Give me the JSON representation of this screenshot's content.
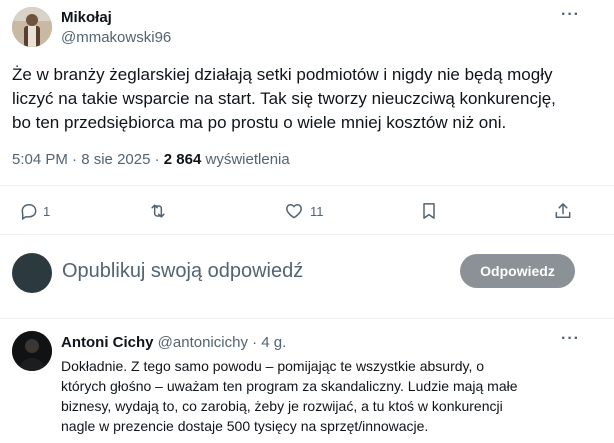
{
  "post": {
    "author_name": "Mikołaj",
    "author_handle": "@mmakowski96",
    "text_line1": "Że w branży żeglarskiej działają setki podmiotów i nigdy nie będą mogły",
    "text_line2": "liczyć na takie wsparcie na start. Tak się tworzy nieuczciwą konkurencję,",
    "text_line3": "bo ten przedsiębiorca ma po prostu o wiele mniej kosztów niż oni.",
    "time": "5:04 PM",
    "sep": "·",
    "date": "8 sie 2025",
    "views_count": "2 864",
    "views_label": "wyświetlenia",
    "more": "···",
    "actions": {
      "reply_count": "1",
      "repost_count": "",
      "like_count": "11",
      "icons": [
        "reply-icon",
        "repost-icon",
        "like-icon",
        "bookmark-icon",
        "share-icon"
      ]
    }
  },
  "composer": {
    "placeholder": "Opublikuj swoją odpowiedź",
    "button_label": "Odpowiedz"
  },
  "reply": {
    "author_name": "Antoni Cichy",
    "author_handle": "@antonicichy",
    "sep": "·",
    "age": "4 g.",
    "more": "···",
    "line1": "Dokładnie. Z tego samo powodu – pomijając te wszystkie absurdy, o",
    "line2": "których głośno – uważam ten program za skandaliczny. Ludzie mają małe",
    "line3": "biznesy, wydają to, co zarobią, żeby je rozwijać, a tu ktoś w konkurencji",
    "line4": "nagle w prezencie dostaje 500 tysięcy na sprzęt/innowacje."
  },
  "colors": {
    "text": "#0f1419",
    "muted": "#536471",
    "button_bg": "#8b9196",
    "divider": "#eff3f4"
  }
}
